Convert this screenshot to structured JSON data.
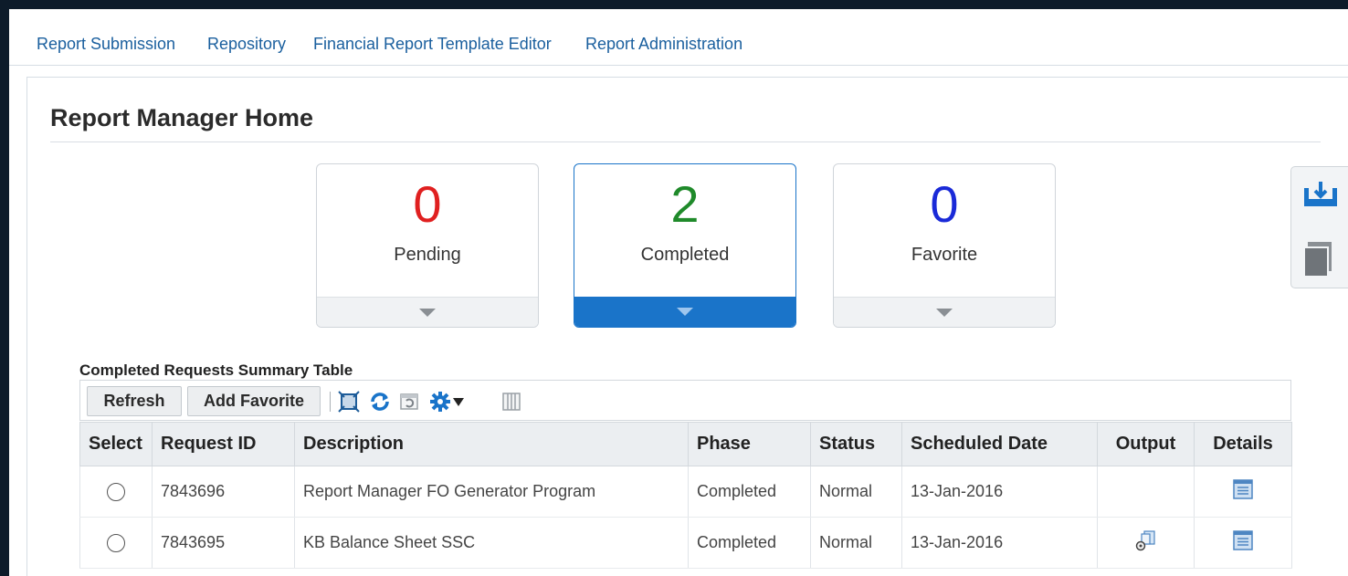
{
  "nav": {
    "items": [
      "Report Submission",
      "Repository",
      "Financial Report Template Editor",
      "Report Administration"
    ]
  },
  "page": {
    "title": "Report Manager Home"
  },
  "tiles": [
    {
      "count": "0",
      "label": "Pending",
      "color": "#e02020",
      "selected": false
    },
    {
      "count": "2",
      "label": "Completed",
      "color": "#1f8a2a",
      "selected": true
    },
    {
      "count": "0",
      "label": "Favorite",
      "color": "#1a2ad8",
      "selected": false
    }
  ],
  "side_tools": {
    "icons": [
      "import-icon",
      "copy-icon"
    ]
  },
  "table": {
    "caption": "Completed Requests Summary Table",
    "toolbar": {
      "refresh_label": "Refresh",
      "add_favorite_label": "Add Favorite",
      "icons": [
        "detach-icon",
        "refresh-icon",
        "reset-icon",
        "settings-icon",
        "freeze-columns-icon"
      ]
    },
    "columns": [
      "Select",
      "Request ID",
      "Description",
      "Phase",
      "Status",
      "Scheduled Date",
      "Output",
      "Details"
    ],
    "rows": [
      {
        "request_id": "7843696",
        "description": "Report Manager FO Generator Program",
        "phase": "Completed",
        "status": "Normal",
        "scheduled_date": "13-Jan-2016",
        "has_output": false
      },
      {
        "request_id": "7843695",
        "description": "KB Balance Sheet SSC",
        "phase": "Completed",
        "status": "Normal",
        "scheduled_date": "13-Jan-2016",
        "has_output": true
      }
    ]
  },
  "colors": {
    "accent": "#1a74c9",
    "link": "#1a5f9e"
  }
}
